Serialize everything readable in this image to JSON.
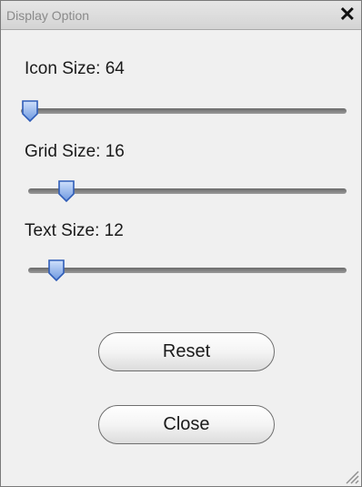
{
  "window": {
    "title": "Display Option",
    "close_glyph": "✕"
  },
  "sliders": [
    {
      "label": "Icon Size: 64",
      "value_fraction": 0.0
    },
    {
      "label": "Grid Size: 16",
      "value_fraction": 0.12
    },
    {
      "label": "Text Size: 12",
      "value_fraction": 0.09
    }
  ],
  "buttons": {
    "reset_label": "Reset",
    "close_label": "Close"
  },
  "icons": {
    "close": "close-icon",
    "thumb": "slider-thumb-icon",
    "grip": "resize-grip-icon"
  },
  "colors": {
    "accent": "#4a78d0",
    "accent_light": "#a9c6f3"
  }
}
